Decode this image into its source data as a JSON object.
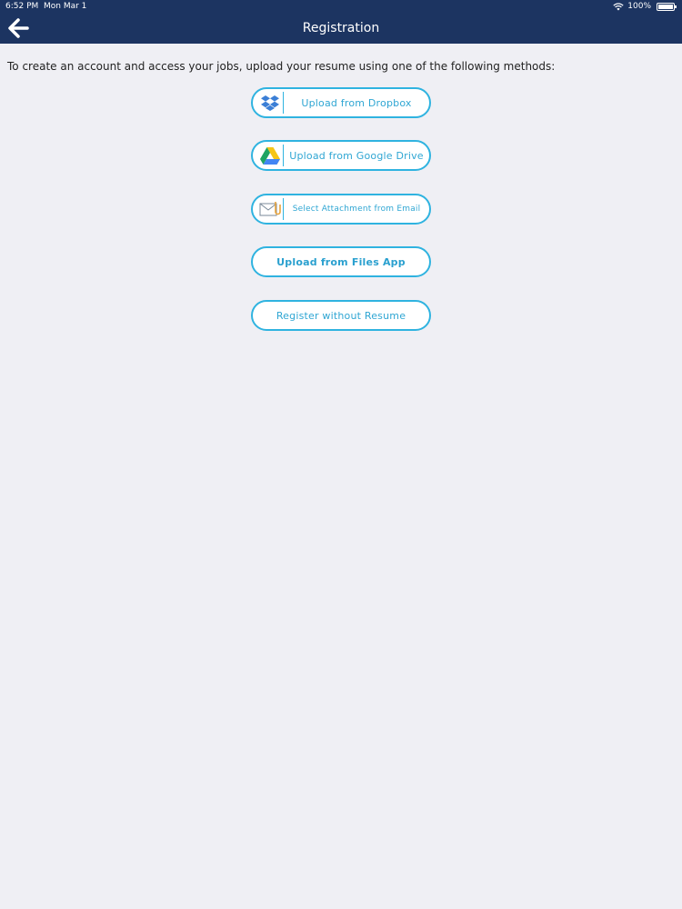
{
  "status_bar": {
    "time": "6:52 PM",
    "date": "Mon Mar 1",
    "battery": "100%"
  },
  "nav": {
    "title": "Registration"
  },
  "intro_text": "To create an account and access your jobs, upload your resume using one of the following methods:",
  "buttons": {
    "dropbox": "Upload from Dropbox",
    "google_drive": "Upload from Google Drive",
    "email": "Select Attachment from Email",
    "files_app": "Upload from Files App",
    "no_resume": "Register without Resume"
  },
  "colors": {
    "nav_bg": "#1c3461",
    "accent": "#2fb3e0",
    "page_bg": "#efeff4"
  }
}
